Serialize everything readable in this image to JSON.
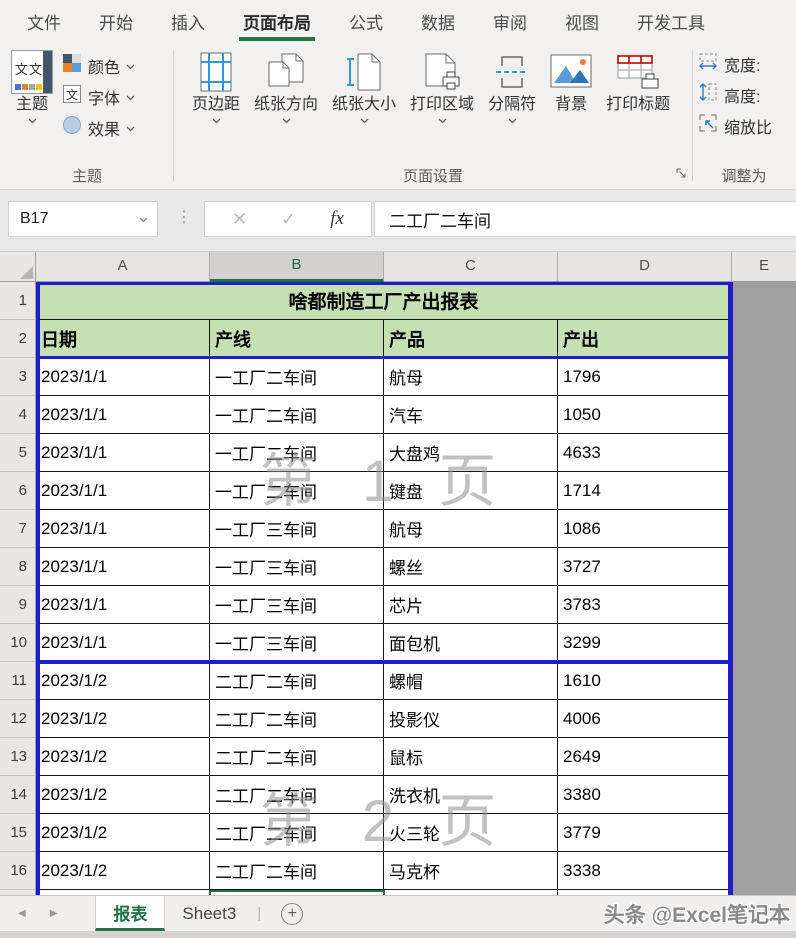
{
  "ribbon": {
    "tabs": [
      "文件",
      "开始",
      "插入",
      "页面布局",
      "公式",
      "数据",
      "审阅",
      "视图",
      "开发工具"
    ],
    "active_tab": "页面布局",
    "themes_group": {
      "label": "主题",
      "theme": "主题",
      "theme_icon_text": "文文",
      "colors": "颜色",
      "fonts": "字体",
      "fonts_icon_text": "文",
      "effects": "效果"
    },
    "page_setup_group": {
      "label": "页面设置",
      "margins": "页边距",
      "orientation": "纸张方向",
      "paper_size": "纸张大小",
      "print_area": "打印区域",
      "breaks": "分隔符",
      "background": "背景",
      "print_titles": "打印标题"
    },
    "scale_group": {
      "label": "调整为",
      "width": "宽度:",
      "height": "高度:",
      "scale": "缩放比"
    }
  },
  "formula_bar": {
    "name_box": "B17",
    "cancel": "✕",
    "enter": "✓",
    "fx": "fx",
    "dots": "⋮",
    "value": "二工厂二车间"
  },
  "grid": {
    "column_headers": [
      "A",
      "B",
      "C",
      "D",
      "E"
    ],
    "selected_column": "B",
    "title_row": {
      "n": "1",
      "title": "啥都制造工厂产出报表"
    },
    "header_row": {
      "n": "2",
      "cells": [
        "日期",
        "产线",
        "产品",
        "产出"
      ]
    },
    "rows": [
      {
        "n": "3",
        "date": "2023/1/1",
        "line": "一工厂二车间",
        "product": "航母",
        "output": "1796"
      },
      {
        "n": "4",
        "date": "2023/1/1",
        "line": "一工厂二车间",
        "product": "汽车",
        "output": "1050"
      },
      {
        "n": "5",
        "date": "2023/1/1",
        "line": "一工厂二车间",
        "product": "大盘鸡",
        "output": "4633"
      },
      {
        "n": "6",
        "date": "2023/1/1",
        "line": "一工厂二车间",
        "product": "键盘",
        "output": "1714"
      },
      {
        "n": "7",
        "date": "2023/1/1",
        "line": "一工厂三车间",
        "product": "航母",
        "output": "1086"
      },
      {
        "n": "8",
        "date": "2023/1/1",
        "line": "一工厂三车间",
        "product": "螺丝",
        "output": "3727"
      },
      {
        "n": "9",
        "date": "2023/1/1",
        "line": "一工厂三车间",
        "product": "芯片",
        "output": "3783"
      },
      {
        "n": "10",
        "date": "2023/1/1",
        "line": "一工厂三车间",
        "product": "面包机",
        "output": "3299"
      },
      {
        "n": "11",
        "date": "2023/1/2",
        "line": "二工厂二车间",
        "product": "螺帽",
        "output": "1610"
      },
      {
        "n": "12",
        "date": "2023/1/2",
        "line": "二工厂二车间",
        "product": "投影仪",
        "output": "4006"
      },
      {
        "n": "13",
        "date": "2023/1/2",
        "line": "二工厂二车间",
        "product": "鼠标",
        "output": "2649"
      },
      {
        "n": "14",
        "date": "2023/1/2",
        "line": "二工厂二车间",
        "product": "洗衣机",
        "output": "3380"
      },
      {
        "n": "15",
        "date": "2023/1/2",
        "line": "二工厂二车间",
        "product": "火三轮",
        "output": "3779"
      },
      {
        "n": "16",
        "date": "2023/1/2",
        "line": "二工厂二车间",
        "product": "马克杯",
        "output": "3338"
      }
    ],
    "watermarks": {
      "page1": "第 1 页",
      "page2": "第 2 页"
    }
  },
  "sheet_bar": {
    "prev": "◀",
    "next": "▶",
    "tabs": [
      "报表",
      "Sheet3"
    ],
    "active_tab": "报表",
    "separator": "|",
    "add": "+",
    "watermark": "头条 @Excel笔记本"
  },
  "colors": {
    "accent_green": "#217346",
    "header_fill": "#c6e0b4",
    "page_break_blue": "#1e1ecd",
    "outside_gray": "#a0a0a0"
  }
}
